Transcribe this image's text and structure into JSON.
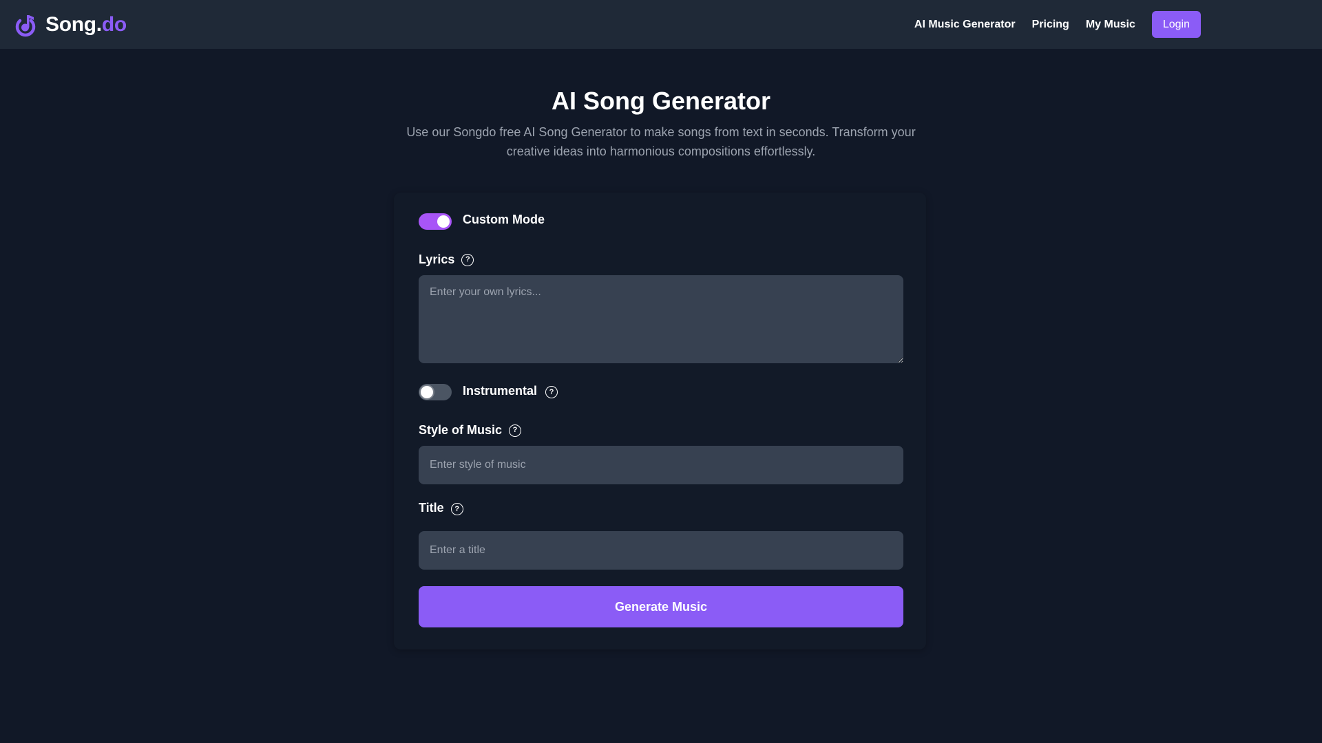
{
  "header": {
    "brand_part1": "Song.",
    "brand_part2": "do",
    "logo_icon": "music-note-circle-icon",
    "nav": [
      {
        "label": "AI Music Generator"
      },
      {
        "label": "Pricing"
      },
      {
        "label": "My Music"
      }
    ],
    "login_label": "Login"
  },
  "hero": {
    "title": "AI Song Generator",
    "subtitle": "Use our Songdo free AI Song Generator to make songs from text in seconds. Transform your creative ideas into harmonious compositions effortlessly."
  },
  "form": {
    "custom_mode": {
      "label": "Custom Mode",
      "enabled": true
    },
    "lyrics": {
      "label": "Lyrics",
      "placeholder": "Enter your own lyrics...",
      "value": "",
      "help_icon": "question-circle-icon"
    },
    "instrumental": {
      "label": "Instrumental",
      "enabled": false,
      "help_icon": "question-circle-icon"
    },
    "style": {
      "label": "Style of Music",
      "placeholder": "Enter style of music",
      "value": "",
      "help_icon": "question-circle-icon"
    },
    "title": {
      "label": "Title",
      "placeholder": "Enter a title",
      "value": "",
      "help_icon": "question-circle-icon"
    },
    "help_glyph": "?",
    "submit_label": "Generate Music"
  },
  "colors": {
    "accent": "#8b5cf6",
    "toggle_on": "#a855f7",
    "background": "#111827",
    "header_bg": "#1f2937",
    "input_bg": "#374151",
    "muted_text": "#9ca3af"
  }
}
